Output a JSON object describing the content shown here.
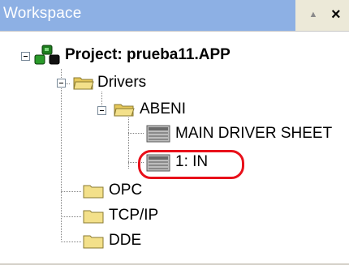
{
  "panel": {
    "title": "Workspace",
    "pin_glyph": "▲",
    "close_glyph": "×"
  },
  "tree": {
    "project": {
      "label": "Project: prueba11.APP",
      "icon": "project-icon",
      "expanded": true
    },
    "drivers": {
      "label": "Drivers",
      "icon": "folder-open-icon",
      "expanded": true
    },
    "abeni": {
      "label": "ABENI",
      "icon": "folder-open-icon",
      "expanded": true
    },
    "main_driver_sheet": {
      "label": "MAIN DRIVER SHEET",
      "icon": "driver-sheet-icon"
    },
    "in_sheet": {
      "label": "1: IN",
      "icon": "driver-sheet-icon",
      "highlighted": true
    },
    "opc": {
      "label": "OPC",
      "icon": "folder-icon"
    },
    "tcpip": {
      "label": "TCP/IP",
      "icon": "folder-icon"
    },
    "dde": {
      "label": "DDE",
      "icon": "folder-icon"
    }
  },
  "colors": {
    "titlebar": "#8db0e4",
    "highlight": "#e8101a",
    "folder": "#f3e08a"
  }
}
